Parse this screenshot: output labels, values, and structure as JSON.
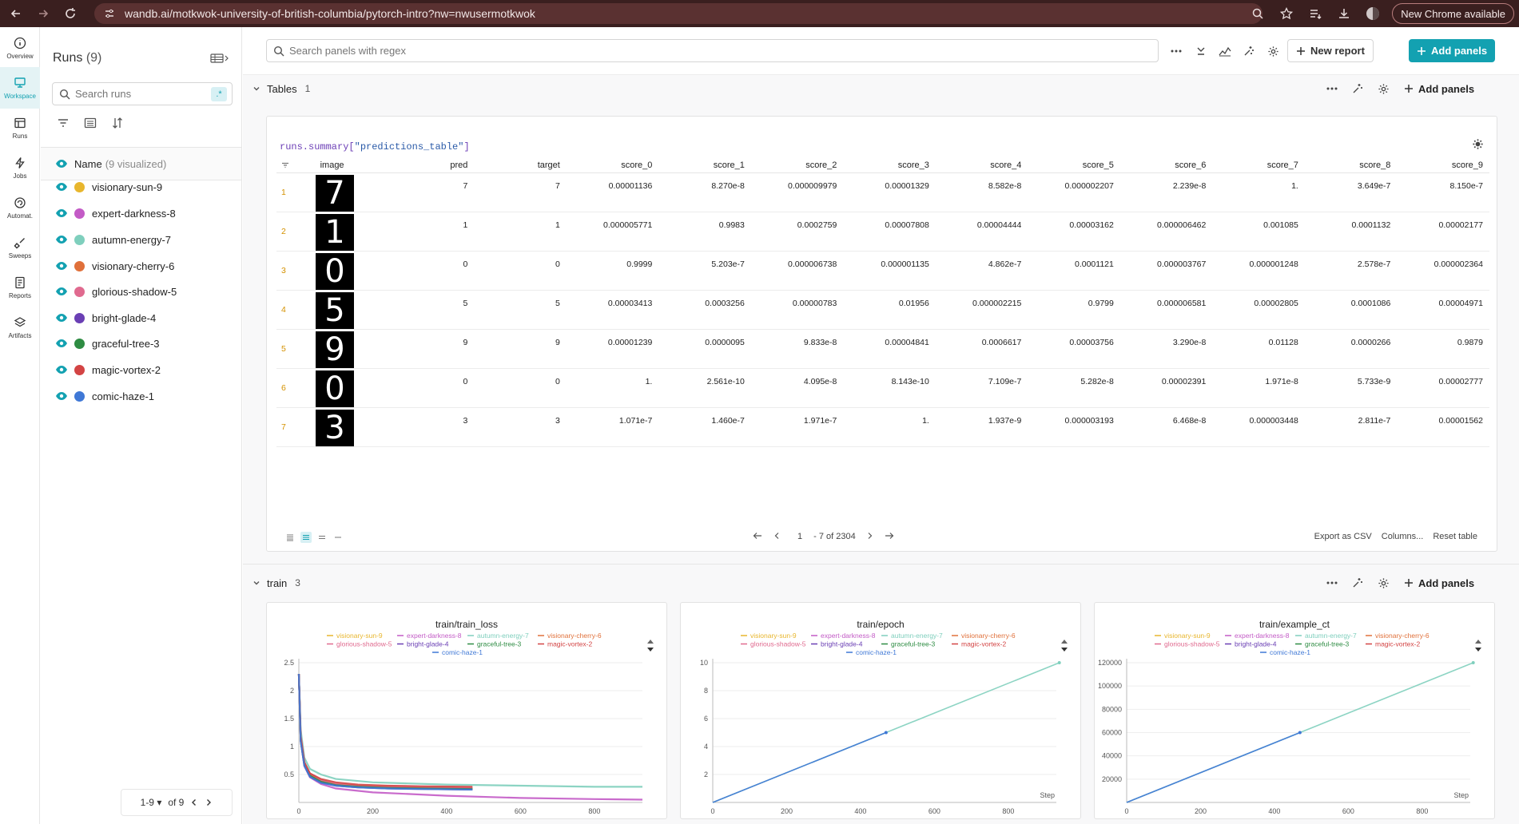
{
  "browser": {
    "url": "wandb.ai/motkwok-university-of-british-columbia/pytorch-intro?nw=nwusermotkwok",
    "new_chrome": "New Chrome available"
  },
  "rail": [
    {
      "label": "Overview",
      "icon": "info-icon"
    },
    {
      "label": "Workspace",
      "icon": "workspace-icon",
      "active": true
    },
    {
      "label": "Runs",
      "icon": "runs-table-icon"
    },
    {
      "label": "Jobs",
      "icon": "lightning-icon"
    },
    {
      "label": "Automat.",
      "icon": "automation-icon"
    },
    {
      "label": "Sweeps",
      "icon": "broom-icon"
    },
    {
      "label": "Reports",
      "icon": "report-icon"
    },
    {
      "label": "Artifacts",
      "icon": "layers-icon"
    }
  ],
  "runs_panel": {
    "title": "Runs",
    "count": "(9)",
    "search_placeholder": "Search runs",
    "regex_label": ".*",
    "name_header": "Name",
    "visualized": "(9 visualized)",
    "pager_range": "1-9",
    "pager_of": "of 9"
  },
  "runs": [
    {
      "name": "visionary-sun-9",
      "color": "#e8b62d"
    },
    {
      "name": "expert-darkness-8",
      "color": "#c35bc6"
    },
    {
      "name": "autumn-energy-7",
      "color": "#7fcfbd"
    },
    {
      "name": "visionary-cherry-6",
      "color": "#e0703a"
    },
    {
      "name": "glorious-shadow-5",
      "color": "#e06a8f"
    },
    {
      "name": "bright-glade-4",
      "color": "#6a3fb4"
    },
    {
      "name": "graceful-tree-3",
      "color": "#2e8c43"
    },
    {
      "name": "magic-vortex-2",
      "color": "#d34444"
    },
    {
      "name": "comic-haze-1",
      "color": "#3f78d6"
    }
  ],
  "toolbar": {
    "search_placeholder": "Search panels with regex",
    "new_report": "New report",
    "add_panels": "Add panels"
  },
  "tables_section": {
    "name": "Tables",
    "count": "1",
    "add_panels": "Add panels",
    "query_prefix": "runs.summary[",
    "query_key": "\"predictions_table\"",
    "query_suffix": "]",
    "columns": [
      "image",
      "pred",
      "target",
      "score_0",
      "score_1",
      "score_2",
      "score_3",
      "score_4",
      "score_5",
      "score_6",
      "score_7",
      "score_8",
      "score_9"
    ],
    "rows": [
      {
        "n": "1",
        "digit": "7",
        "cells": [
          "7",
          "7",
          "0.00001136",
          "8.270e-8",
          "0.000009979",
          "0.00001329",
          "8.582e-8",
          "0.000002207",
          "2.239e-8",
          "1.",
          "3.649e-7",
          "8.150e-7"
        ]
      },
      {
        "n": "2",
        "digit": "1",
        "cells": [
          "1",
          "1",
          "0.000005771",
          "0.9983",
          "0.0002759",
          "0.00007808",
          "0.00004444",
          "0.00003162",
          "0.000006462",
          "0.001085",
          "0.0001132",
          "0.00002177"
        ]
      },
      {
        "n": "3",
        "digit": "0",
        "cells": [
          "0",
          "0",
          "0.9999",
          "5.203e-7",
          "0.000006738",
          "0.000001135",
          "4.862e-7",
          "0.0001121",
          "0.000003767",
          "0.000001248",
          "2.578e-7",
          "0.000002364"
        ]
      },
      {
        "n": "4",
        "digit": "5",
        "cells": [
          "5",
          "5",
          "0.00003413",
          "0.0003256",
          "0.00000783",
          "0.01956",
          "0.000002215",
          "0.9799",
          "0.000006581",
          "0.00002805",
          "0.0001086",
          "0.00004971"
        ]
      },
      {
        "n": "5",
        "digit": "9",
        "cells": [
          "9",
          "9",
          "0.00001239",
          "0.0000095",
          "9.833e-8",
          "0.00004841",
          "0.0006617",
          "0.00003756",
          "3.290e-8",
          "0.01128",
          "0.0000266",
          "0.9879"
        ]
      },
      {
        "n": "6",
        "digit": "0",
        "cells": [
          "0",
          "0",
          "1.",
          "2.561e-10",
          "4.095e-8",
          "8.143e-10",
          "7.109e-7",
          "5.282e-8",
          "0.00002391",
          "1.971e-8",
          "5.733e-9",
          "0.00002777"
        ]
      },
      {
        "n": "7",
        "digit": "3",
        "cells": [
          "3",
          "3",
          "1.071e-7",
          "1.460e-7",
          "1.971e-7",
          "1.",
          "1.937e-9",
          "0.000003193",
          "6.468e-8",
          "0.000003448",
          "2.811e-7",
          "0.00001562"
        ]
      }
    ],
    "pager_page": "1",
    "pager_info": "- 7 of 2304",
    "export_csv": "Export as CSV",
    "columns_btn": "Columns...",
    "reset_table": "Reset table"
  },
  "train_section": {
    "name": "train",
    "count": "3",
    "add_panels": "Add panels"
  },
  "chart_data": [
    {
      "type": "line",
      "title": "train/train_loss",
      "xlabel": "",
      "ylabel": "",
      "xlim": [
        0,
        930
      ],
      "ylim": [
        0,
        2.5
      ],
      "xticks": [
        0,
        200,
        400,
        600,
        800
      ],
      "yticks": [
        0.5,
        1,
        1.5,
        2,
        2.5
      ],
      "legend": "top",
      "series": [
        {
          "name": "visionary-sun-9",
          "color": "#e8b62d",
          "x": [
            0,
            5,
            15,
            30,
            60,
            100,
            160,
            240,
            330,
            470
          ],
          "y": [
            2.3,
            1.2,
            0.7,
            0.5,
            0.4,
            0.33,
            0.3,
            0.28,
            0.26,
            0.25
          ]
        },
        {
          "name": "expert-darkness-8",
          "color": "#c35bc6",
          "x": [
            0,
            5,
            15,
            30,
            60,
            100,
            200,
            400,
            600,
            800,
            930
          ],
          "y": [
            2.3,
            1.1,
            0.65,
            0.45,
            0.33,
            0.25,
            0.18,
            0.12,
            0.08,
            0.06,
            0.05
          ]
        },
        {
          "name": "autumn-energy-7",
          "color": "#7fcfbd",
          "x": [
            0,
            5,
            15,
            30,
            60,
            100,
            200,
            400,
            600,
            800,
            930
          ],
          "y": [
            2.3,
            1.3,
            0.8,
            0.6,
            0.5,
            0.42,
            0.36,
            0.32,
            0.3,
            0.28,
            0.28
          ]
        },
        {
          "name": "visionary-cherry-6",
          "color": "#e0703a",
          "x": [
            0,
            5,
            15,
            30,
            60,
            100,
            160,
            240,
            330,
            470
          ],
          "y": [
            2.3,
            1.15,
            0.7,
            0.5,
            0.38,
            0.32,
            0.28,
            0.27,
            0.26,
            0.26
          ]
        },
        {
          "name": "glorious-shadow-5",
          "color": "#e06a8f",
          "x": [
            0,
            5,
            15,
            30,
            60,
            100,
            160,
            240,
            330,
            470
          ],
          "y": [
            2.3,
            1.2,
            0.72,
            0.52,
            0.4,
            0.33,
            0.3,
            0.28,
            0.27,
            0.26
          ]
        },
        {
          "name": "bright-glade-4",
          "color": "#6a3fb4",
          "x": [
            0,
            5,
            15,
            30,
            60,
            100,
            160,
            240,
            330,
            470
          ],
          "y": [
            2.3,
            1.1,
            0.66,
            0.46,
            0.36,
            0.3,
            0.27,
            0.25,
            0.24,
            0.23
          ]
        },
        {
          "name": "graceful-tree-3",
          "color": "#2e8c43",
          "x": [
            0,
            5,
            15,
            30,
            60,
            100,
            160,
            240,
            330,
            470
          ],
          "y": [
            2.3,
            1.12,
            0.68,
            0.48,
            0.37,
            0.31,
            0.28,
            0.26,
            0.25,
            0.24
          ]
        },
        {
          "name": "magic-vortex-2",
          "color": "#d34444",
          "x": [
            0,
            5,
            15,
            30,
            60,
            100,
            160,
            240,
            330,
            470
          ],
          "y": [
            2.3,
            1.18,
            0.72,
            0.52,
            0.42,
            0.36,
            0.32,
            0.3,
            0.29,
            0.28
          ]
        },
        {
          "name": "comic-haze-1",
          "color": "#3f78d6",
          "x": [
            0,
            5,
            15,
            30,
            60,
            100,
            160,
            240,
            330,
            470
          ],
          "y": [
            2.3,
            1.1,
            0.66,
            0.46,
            0.35,
            0.3,
            0.27,
            0.25,
            0.24,
            0.23
          ]
        }
      ]
    },
    {
      "type": "line",
      "title": "train/epoch",
      "xlabel": "Step",
      "ylabel": "",
      "xlim": [
        0,
        930
      ],
      "ylim": [
        0,
        10
      ],
      "xticks": [
        0,
        200,
        400,
        600,
        800
      ],
      "yticks": [
        2,
        4,
        6,
        8,
        10
      ],
      "legend": "top",
      "series": [
        {
          "name": "autumn-energy-7",
          "color": "#7fcfbd",
          "x": [
            0,
            469,
            938
          ],
          "y": [
            0,
            5,
            10
          ]
        },
        {
          "name": "comic-haze-1",
          "color": "#3f78d6",
          "x": [
            0,
            469
          ],
          "y": [
            0,
            5
          ]
        }
      ]
    },
    {
      "type": "line",
      "title": "train/example_ct",
      "xlabel": "Step",
      "ylabel": "",
      "xlim": [
        0,
        930
      ],
      "ylim": [
        0,
        120000
      ],
      "xticks": [
        0,
        200,
        400,
        600,
        800
      ],
      "yticks": [
        20000,
        40000,
        60000,
        80000,
        100000,
        120000
      ],
      "legend": "top",
      "series": [
        {
          "name": "autumn-energy-7",
          "color": "#7fcfbd",
          "x": [
            0,
            469,
            938
          ],
          "y": [
            0,
            60000,
            120000
          ]
        },
        {
          "name": "comic-haze-1",
          "color": "#3f78d6",
          "x": [
            0,
            469
          ],
          "y": [
            0,
            60000
          ]
        }
      ]
    }
  ]
}
